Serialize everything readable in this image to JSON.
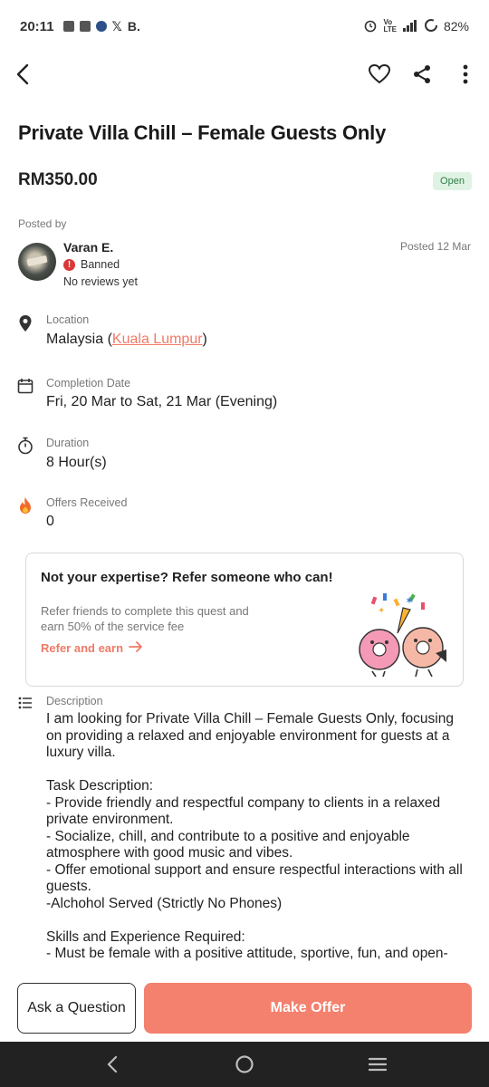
{
  "status_bar": {
    "time": "20:11",
    "left_letter": "B.",
    "battery": "82%",
    "icons": [
      "shopping-bag-icon",
      "mail-icon",
      "maybank-icon",
      "x-icon",
      "alarm-icon",
      "volte-icon",
      "signal-icon",
      "battery-icon"
    ]
  },
  "nav": {
    "icons": [
      "back-arrow-icon",
      "heart-icon",
      "share-icon",
      "more-vertical-icon"
    ]
  },
  "listing": {
    "title": "Private Villa Chill – Female Guests Only",
    "price": "RM350.00",
    "status": "Open"
  },
  "poster": {
    "section_label": "Posted by",
    "name": "Varan E.",
    "status": "Banned",
    "reviews": "No reviews yet",
    "posted_date": "Posted 12 Mar"
  },
  "details": {
    "location_label": "Location",
    "location_country": "Malaysia",
    "location_city": "Kuala Lumpur",
    "completion_label": "Completion Date",
    "completion_value": "Fri, 20 Mar to Sat, 21 Mar (Evening)",
    "duration_label": "Duration",
    "duration_value": "8 Hour(s)",
    "offers_label": "Offers Received",
    "offers_value": "0"
  },
  "referral": {
    "title": "Not your expertise? Refer someone who can!",
    "subtitle": "Refer friends to complete this quest and earn 50% of the service fee",
    "link": "Refer and earn"
  },
  "description": {
    "label": "Description",
    "body": "I am looking for Private Villa Chill – Female Guests Only, focusing on providing a relaxed and enjoyable environment for guests at a luxury villa.\n\nTask Description:\n- Provide friendly and respectful company to clients in a relaxed private environment.\n- Socialize, chill, and contribute to a positive and enjoyable atmosphere with good music and vibes.\n- Offer emotional support and ensure respectful interactions with all guests.\n-Alchohol Served (Strictly No Phones)\n\nSkills and Experience Required:\n- Must be female with a positive attitude, sportive, fun, and open-"
  },
  "actions": {
    "ask": "Ask a Question",
    "offer": "Make Offer"
  },
  "theme": {
    "accent": "#f4806e",
    "open_badge_bg": "#dff3e4",
    "open_badge_text": "#2e7d46",
    "banned_red": "#d93838"
  }
}
